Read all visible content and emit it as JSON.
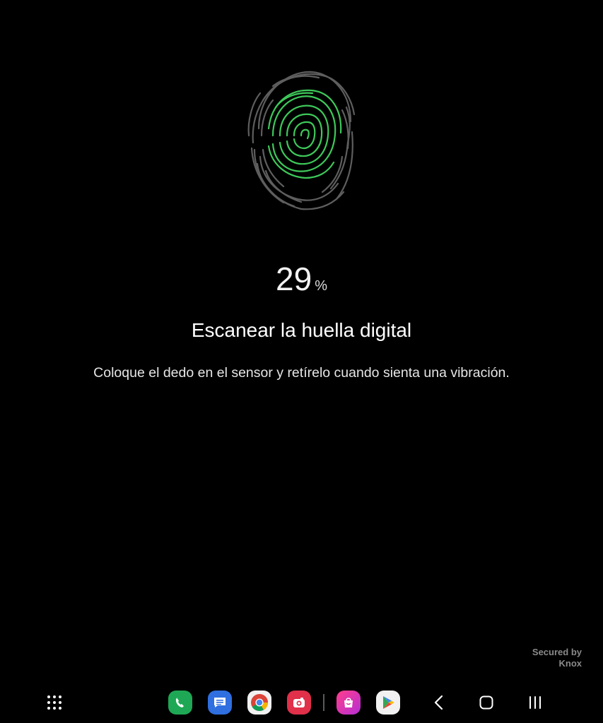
{
  "progress": {
    "value": 29,
    "value_text": "29",
    "unit": "%"
  },
  "title": "Escanear la huella digital",
  "subtitle": "Coloque el dedo en el sensor y retírelo cuando sienta una vibración.",
  "knox": {
    "line1": "Secured by",
    "line2": "Knox"
  },
  "colors": {
    "background": "#000000",
    "fingerprint_scanned": "#3ec85a",
    "fingerprint_unscanned": "#5e5e5e"
  },
  "taskbar": {
    "apps": [
      {
        "icon": "apps-grid-icon"
      },
      {
        "icon": "phone-icon"
      },
      {
        "icon": "messages-icon"
      },
      {
        "icon": "chrome-icon"
      },
      {
        "icon": "camera-icon"
      },
      {
        "icon": "galaxy-store-icon"
      },
      {
        "icon": "play-store-icon"
      }
    ],
    "nav": [
      {
        "icon": "back-icon"
      },
      {
        "icon": "home-icon"
      },
      {
        "icon": "recents-icon"
      }
    ]
  }
}
